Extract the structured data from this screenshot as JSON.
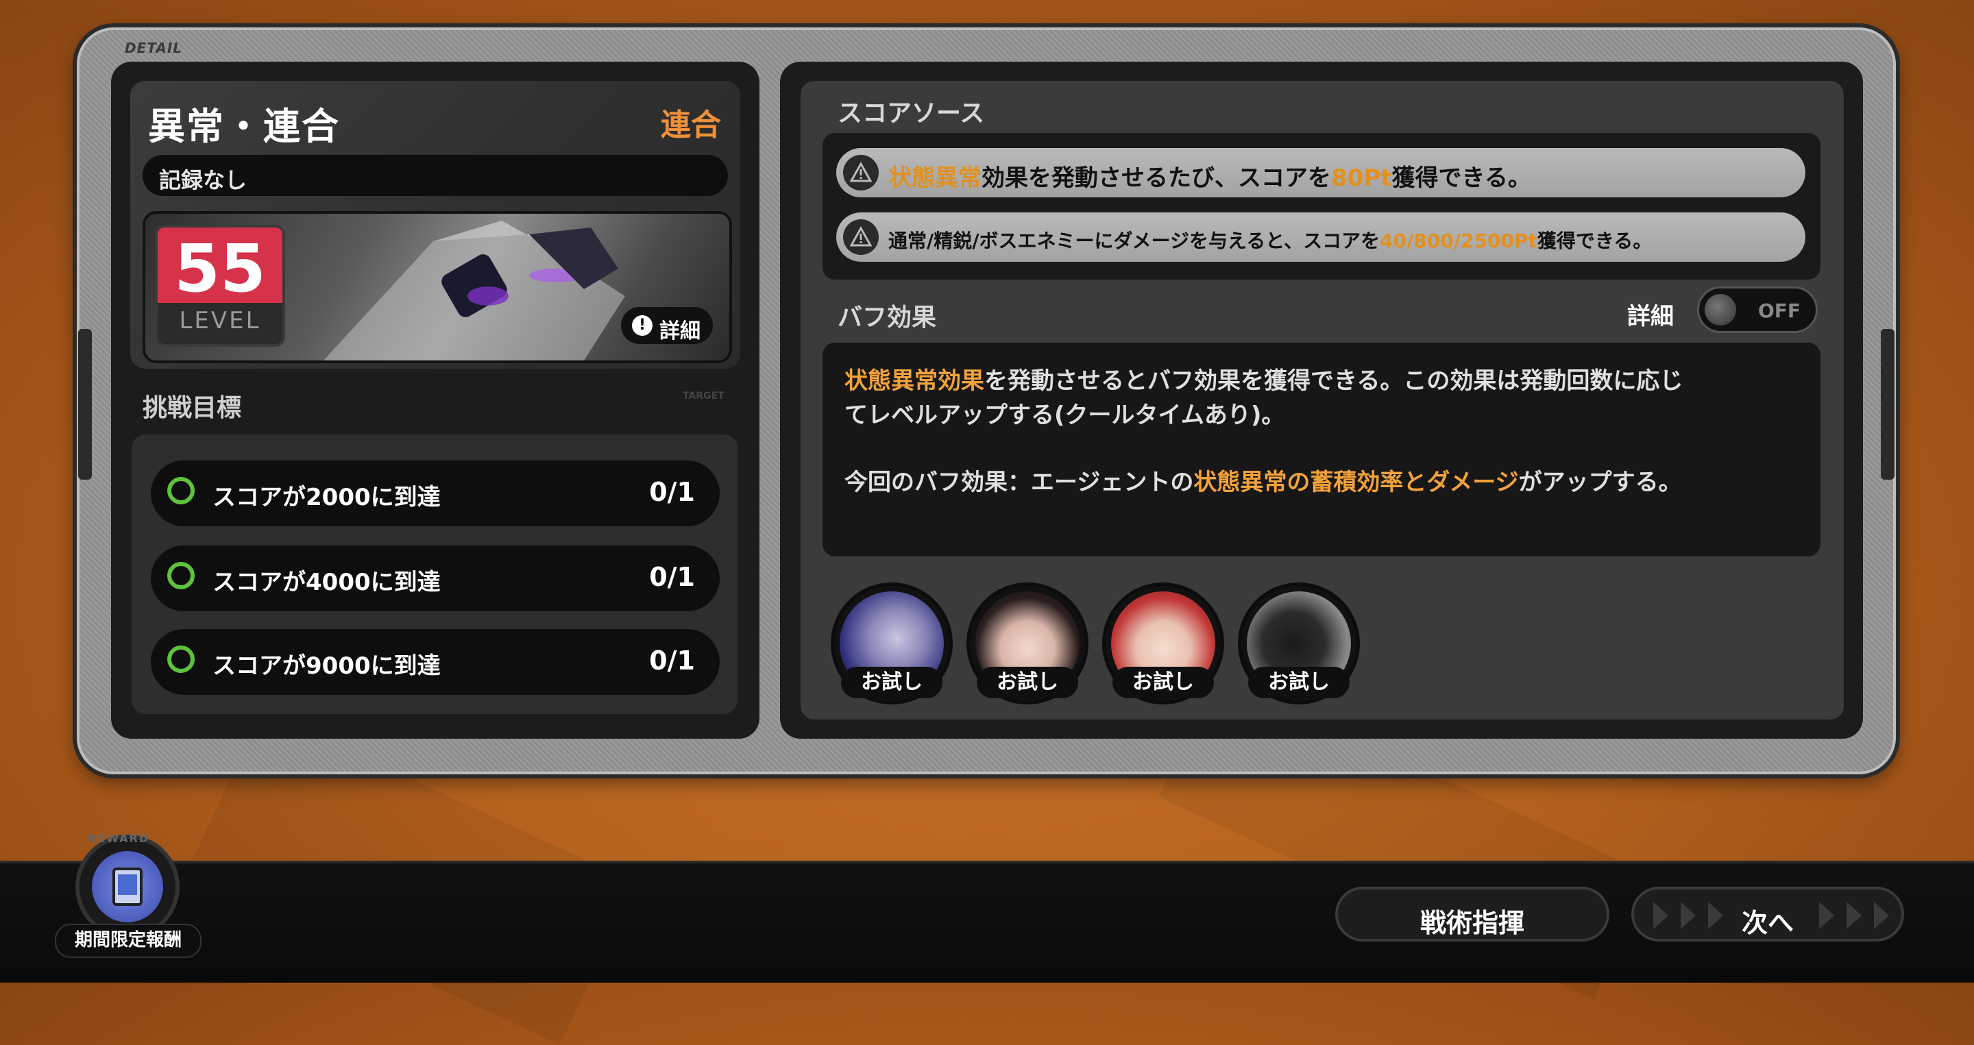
{
  "frame": {
    "detail_tag": "DETAIL"
  },
  "left": {
    "mode_title": "異常・連合",
    "mode_tag": "連合",
    "record": "記録なし",
    "level_number": "55",
    "level_label": "LEVEL",
    "detail_button": "詳細",
    "target_title": "挑戦目標",
    "target_tag": "TARGET",
    "goals": [
      {
        "text": "スコアが2000に到達",
        "count": "0/1"
      },
      {
        "text": "スコアが4000に到達",
        "count": "0/1"
      },
      {
        "text": "スコアが9000に到達",
        "count": "0/1"
      }
    ]
  },
  "right": {
    "score_title": "スコアソース",
    "score_line1": {
      "hl1": "状態異常",
      "t1": "効果を発動させるたび、スコアを",
      "hl2": "80Pt",
      "t2": "獲得できる。"
    },
    "score_line2": {
      "t1": "通常/精鋭/ボスエネミーにダメージを与えると、スコアを",
      "hl": "40/800/2500Pt",
      "t2": "獲得できる。"
    },
    "buff_title": "バフ効果",
    "toggle_label": "詳細",
    "toggle_state": "OFF",
    "buff_p1": {
      "hl1": "状態異常効果",
      "t1": "を発動させると",
      "hl2": "バフ効果",
      "t2": "を獲得できる。この効果は",
      "hl3": "発動回数",
      "t3": "に応じ"
    },
    "buff_p1_line2": "てレベルアップする(クールタイムあり)。",
    "buff_p2": {
      "t1": "今回の",
      "hl1": "バフ効果",
      "t2": "：エージェントの",
      "hl2": "状態異常の蓄積効率とダメージ",
      "t3": "がアップする。"
    },
    "agents": [
      {
        "label": "お試し"
      },
      {
        "label": "お試し"
      },
      {
        "label": "お試し"
      },
      {
        "label": "お試し"
      }
    ]
  },
  "bottom": {
    "reward_label": "期間限定報酬",
    "reward_tag": "REWARD",
    "tactics_button": "戦術指揮",
    "next_button": "次へ"
  },
  "colors": {
    "accent": "#f2a23b",
    "level_red": "#d6334a",
    "goal_ring": "#5fc23c"
  }
}
